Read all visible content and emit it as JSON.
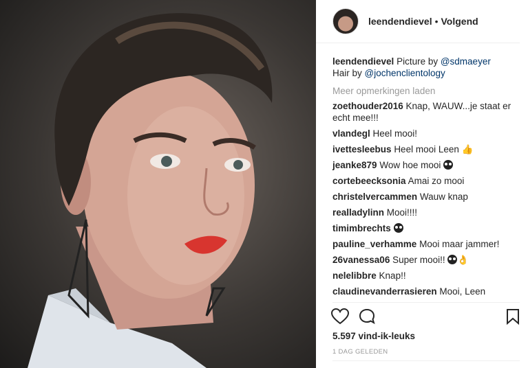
{
  "post": {
    "username": "leendendievel",
    "dot": "•",
    "follow_label": "Volgend",
    "caption_pre": "Picture by ",
    "caption_link1": "@sdmaeyer",
    "caption_mid": "Hair by ",
    "caption_link2": "@jochenclientology",
    "load_more": "Meer opmerkingen laden",
    "likes": "5.597 vind-ik-leuks",
    "date": "1 DAG GELEDEN"
  },
  "comments": [
    {
      "user": "zoethouder2016",
      "text": "Knap, WAUW...je staat er echt mee!!!",
      "emoji": ""
    },
    {
      "user": "vlandegl",
      "text": "Heel mooi!",
      "emoji": ""
    },
    {
      "user": "ivettesleebus",
      "text": "Heel mooi Leen",
      "emoji": "thumbs-up"
    },
    {
      "user": "jeanke879",
      "text": "Wow hoe mooi",
      "emoji": "heart-eyes"
    },
    {
      "user": "cortebeecksonia",
      "text": "Amai zo mooi",
      "emoji": ""
    },
    {
      "user": "christelvercammen",
      "text": "Wauw knap",
      "emoji": ""
    },
    {
      "user": "realladylinn",
      "text": "Mooi!!!!",
      "emoji": ""
    },
    {
      "user": "timimbrechts",
      "text": "",
      "emoji": "heart-eyes"
    },
    {
      "user": "pauline_verhamme",
      "text": "Mooi maar jammer!",
      "emoji": ""
    },
    {
      "user": "26vanessa06",
      "text": "Super mooi!!",
      "emoji": "heart-eyes ok-hand"
    },
    {
      "user": "nelelibbre",
      "text": "Knap!!",
      "emoji": ""
    },
    {
      "user": "claudinevanderrasieren",
      "text": "Mooi, Leen",
      "emoji": ""
    }
  ],
  "icons": {
    "like": "heart-icon",
    "comment": "comment-icon",
    "save": "bookmark-icon"
  }
}
